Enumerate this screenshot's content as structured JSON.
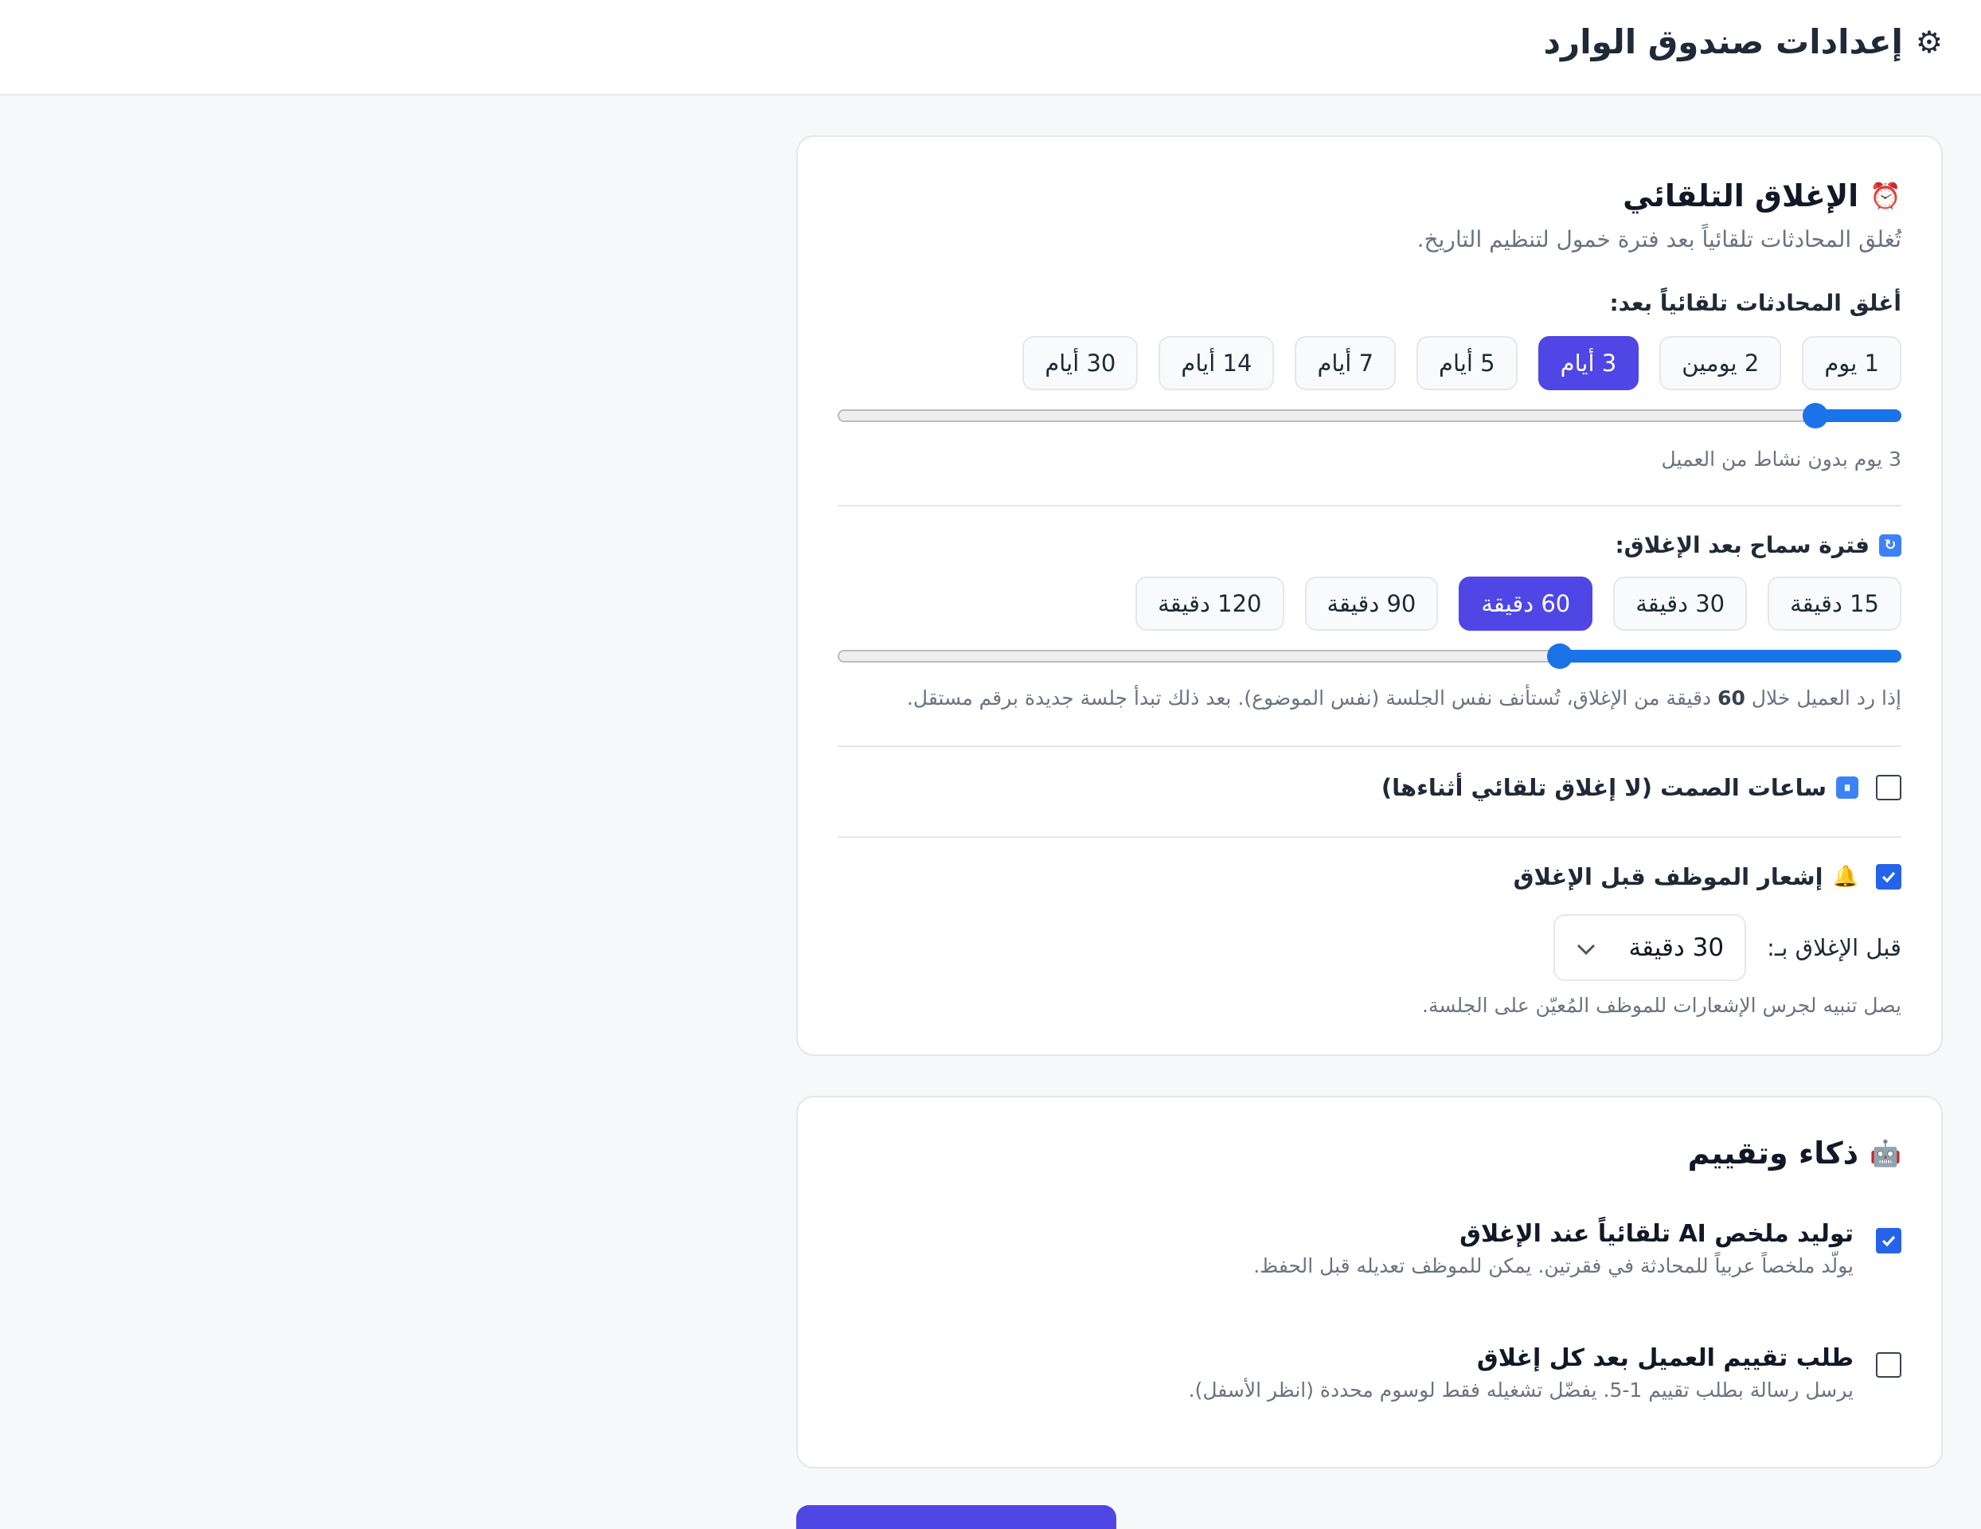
{
  "header": {
    "title": "إعدادات صندوق الوارد",
    "icon": "gear-icon"
  },
  "auto_close": {
    "title": "الإغلاق التلقائي",
    "icon": "alarm-clock-icon",
    "subtitle": "تُغلق المحادثات تلقائياً بعد فترة خمول لتنظيم التاريخ.",
    "close_after_label": "أغلق المحادثات تلقائياً بعد:",
    "day_options": [
      "1 يوم",
      "2 يومين",
      "3 أيام",
      "5 أيام",
      "7 أيام",
      "14 أيام",
      "30 أيام"
    ],
    "day_selected_index": 2,
    "day_slider_fraction": 0.0811,
    "day_hint": "3 يوم بدون نشاط من العميل",
    "grace_label": "فترة سماح بعد الإغلاق:",
    "grace_icon": "refresh-icon",
    "grace_options": [
      "15 دقيقة",
      "30 دقيقة",
      "60 دقيقة",
      "90 دقيقة",
      "120 دقيقة"
    ],
    "grace_selected_index": 2,
    "grace_slider_fraction": 0.3214,
    "grace_hint_pre": "إذا رد العميل خلال ",
    "grace_hint_value": "60",
    "grace_hint_post": " دقيقة من الإغلاق، تُستأنف نفس الجلسة (نفس الموضوع). بعد ذلك تبدأ جلسة جديدة برقم مستقل.",
    "quiet_hours": {
      "label": "ساعات الصمت (لا إغلاق تلقائي أثناءها)",
      "checked": false,
      "icon": "pause-icon"
    },
    "notify_agent": {
      "label": "إشعار الموظف قبل الإغلاق",
      "checked": true,
      "icon": "bell-icon"
    },
    "before_close_label": "قبل الإغلاق بـ:",
    "before_close_value": "30 دقيقة",
    "notify_hint": "يصل تنبيه لجرس الإشعارات للموظف المُعيّن على الجلسة."
  },
  "ai_rating": {
    "title": "ذكاء وتقييم",
    "icon": "robot-icon",
    "ai_summary": {
      "label": "توليد ملخص AI تلقائياً عند الإغلاق",
      "desc": "يولّد ملخصاً عربياً للمحادثة في فقرتين. يمكن للموظف تعديله قبل الحفظ.",
      "checked": true
    },
    "rating": {
      "label": "طلب تقييم العميل بعد كل إغلاق",
      "desc": "يرسل رسالة بطلب تقييم 1-5. يفضّل تشغيله فقط لوسوم محددة (انظر الأسفل).",
      "checked": false
    }
  }
}
